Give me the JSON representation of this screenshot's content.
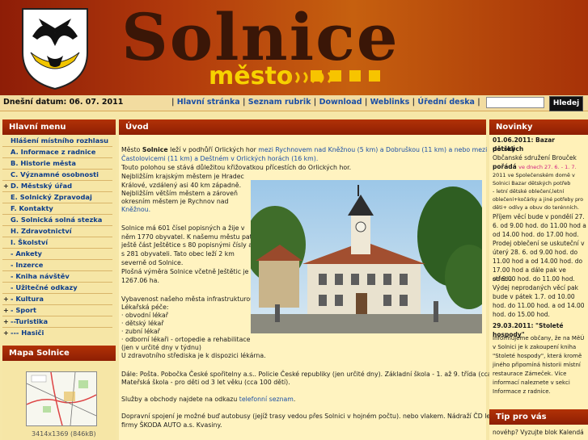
{
  "header": {
    "title": "Solnice",
    "subtitle": "město",
    "accent_color": "#f7c400"
  },
  "topbar": {
    "date_label": "Dnešní datum: 06. 07. 2011",
    "nav": [
      "Hlavní stránka",
      "Seznam rubrik",
      "Download",
      "Weblinks",
      "Úřední deska"
    ],
    "search_value": "",
    "search_button": "Hledej"
  },
  "left_menu": {
    "title": "Hlavní menu",
    "items": [
      {
        "label": "Hlášení místního rozhlasu",
        "expand": ""
      },
      {
        "label": "A. Informace z radnice",
        "expand": ""
      },
      {
        "label": "B. Historie města",
        "expand": ""
      },
      {
        "label": "C. Významné osobnosti",
        "expand": ""
      },
      {
        "label": "D. Městský úřad",
        "expand": "+"
      },
      {
        "label": "E. Solnický Zpravodaj",
        "expand": ""
      },
      {
        "label": "F. Kontakty",
        "expand": ""
      },
      {
        "label": "G. Solnická solná stezka",
        "expand": ""
      },
      {
        "label": "H. Zdravotnictví",
        "expand": ""
      },
      {
        "label": "I. Školství",
        "expand": ""
      },
      {
        "label": "- Ankety",
        "expand": ""
      },
      {
        "label": "- Inzerce",
        "expand": ""
      },
      {
        "label": "- Kniha návštěv",
        "expand": ""
      },
      {
        "label": "- Užitečné odkazy",
        "expand": ""
      },
      {
        "label": "- Kultura",
        "expand": "+"
      },
      {
        "label": "- Sport",
        "expand": "+"
      },
      {
        "label": "--Turistika",
        "expand": "+"
      },
      {
        "label": "--- Hasiči",
        "expand": "+"
      }
    ]
  },
  "map_panel": {
    "title": "Mapa Solnice",
    "caption": "3414x1369 (846kB)"
  },
  "main": {
    "title": "Úvod",
    "intro_1": "Město Solnice leží v podhůří Orlických hor mezi Rychnovem nad Kněžnou (5 km) a Dobruškou (11 km) a nebo mezi",
    "intro_2": "Častolovicemi (11 km) a Deštném v Orlických horách (16 km).",
    "intro_3": "Touto polohou se stává důležitou křižovatkou přícestích do Orlických hor.",
    "intro_4": "Nejbližším krajským městem je Hradec",
    "intro_5": "Králové, vzdálený asi 40 km západně.",
    "intro_6": "Nejbližším větším městem a zároveň",
    "intro_7": "okresním městem je Rychnov nad",
    "intro_8": "Kněžnou.",
    "pop_1": "Solnice má 601 čísel popisných a žije v",
    "pop_2": "něm 1770 obyvatel. K našemu městu patří",
    "pop_3": "ještě část Ještětice s 80 popisnými čísly a",
    "pop_4": "s 281 obyvateli. Tato obec leží 2 km",
    "pop_5": "severně od Solnice.",
    "pop_6": "Plošná výměra Solnice včetně Ještětic je",
    "pop_7": "1267.06 ha.",
    "vyb_1": "Vybavenost našeho města infrastrukturou:",
    "vyb_2": "Lékařská péče:",
    "vyb_3": "· obvodní lékař",
    "vyb_4": "· dětský lékař",
    "vyb_5": "· zubní lékař",
    "vyb_6": "· odborní lékaři - ortopedie a rehabilitace",
    "vyb_7": "(jen v určité dny v týdnu)",
    "vyb_8": "U zdravotního střediska je k dispozici lékárna.",
    "dale_1": "Dále: Pošta. Pobočka České spořitelny a.s.. Policie České republiky (jen určité dny). Základní škola - 1. až 9. třída (cca 268 žáků).",
    "dale_2": "Mateřská škola - pro děti od 3 let věku (cca 100 dětí).",
    "sluzby": "Služby a obchody najdete na odkazu telefonní seznam.",
    "doprava_1": "Dopravní spojení je možné buď autobusy (jejíž trasy vedou přes Solnici v hojném počtu). nebo vlakem. Nádraží ČD leží poblíž",
    "doprava_2": "firmy ŠKODA AUTO a.s. Kvasiny."
  },
  "news": {
    "title": "Novinky",
    "n1_date": "01.06.2011: Bazar dětských",
    "n1_date2": "potřeb",
    "n1_l1": "Občanské sdružení Brouček",
    "n1_l2": "pořádá ve dnech 27. 6. - 1. 7.",
    "n1_l3": "2011 ve Společenském domě v",
    "n1_l4": "Solnici Bazar dětských potřeb",
    "n1_l5": "- letní dětské oblečení,letní",
    "n1_l6": "oblečení+kočárky a jiné potřeby pro",
    "n1_l7": "děti+ odívy a obuv do terénních.",
    "n1_l8": "Příjem věcí bude v pondělí 27.",
    "n1_l9": "6. od 9.00 hod. do 11.00 hod a",
    "n1_l10": "od 14.00 hod. do 17.00 hod.",
    "n1_l11": "Prodej oblečení se uskuteční v",
    "n1_l12": "úterý 28. 6. od 9.00 hod. do",
    "n1_l13": "11.00 hod a od 14.00 hod. do",
    "n1_l14": "17.00 hod a dále pak ve středu",
    "n1_l15": "od 9.00 hod. do 11.00 hod.",
    "n1_l16": "Výdej neprodaných věcí pak",
    "n1_l17": "bude v pátek 1.7. od 10.00",
    "n1_l18": "hod. do 11.00 hod. a od 14.00",
    "n1_l19": "hod. do 15.00 hod.",
    "n2_date": "29.03.2011: \"Stoleté hospody\"",
    "n2_l1": "Informujeme občany, že na MěÚ",
    "n2_l2": "v Solnici je k zakoupení kniha",
    "n2_l3": "\"Stoleté hospody\", která kromě",
    "n2_l4": "jiného připomíná historii místní",
    "n2_l5": "restaurace Zámeček. Více",
    "n2_l6": "informací naleznete v sekci",
    "n2_l7": "Informace z radnice."
  },
  "tip": {
    "title": "Tip pro vás",
    "text": "novéhp? Vyzujte blok Kalendá"
  }
}
